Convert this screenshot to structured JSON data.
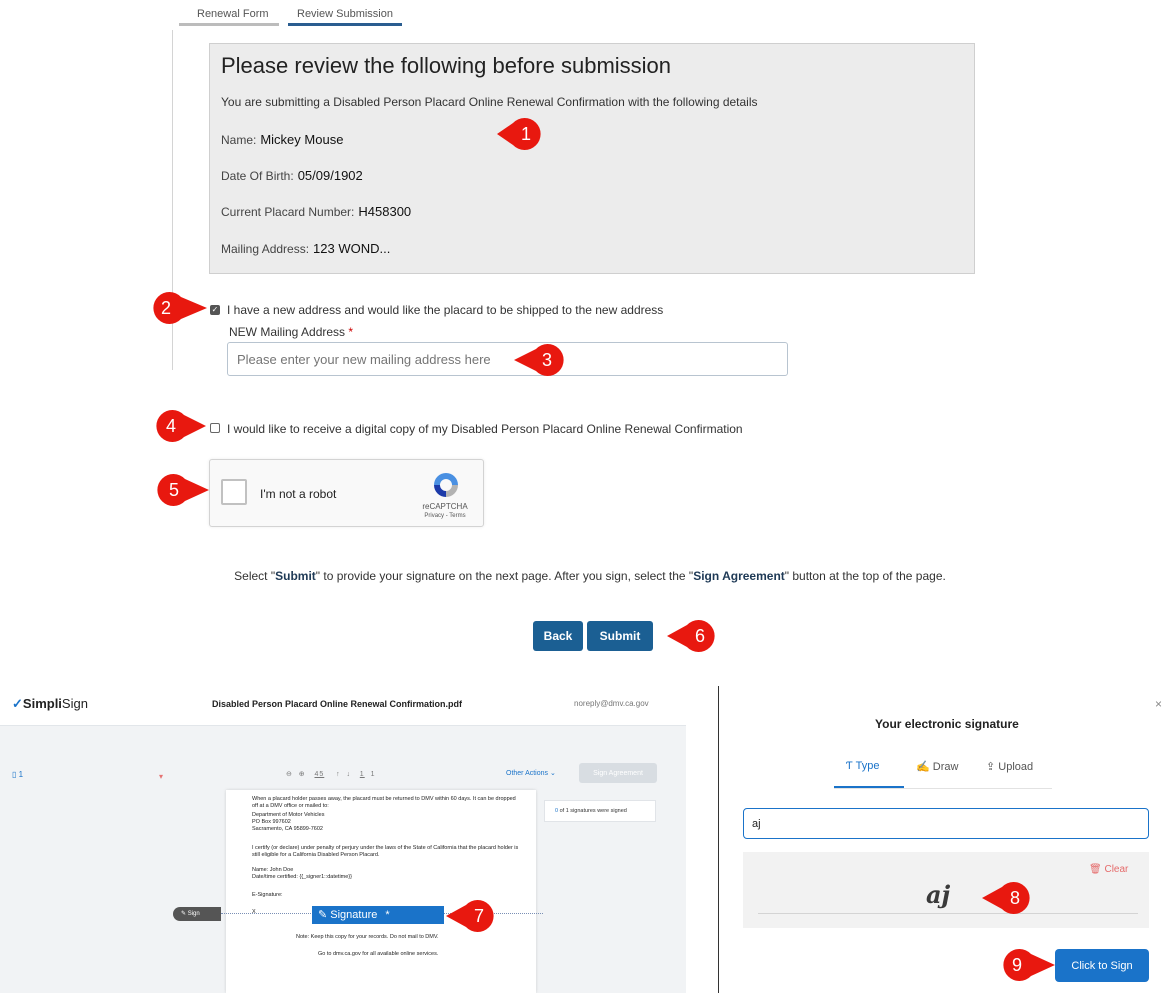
{
  "tabs": [
    "Renewal Form",
    "Review Submission"
  ],
  "review": {
    "title": "Please review the following before submission",
    "subtitle": "You are submitting a Disabled Person Placard Online Renewal Confirmation with the following details",
    "name_label": "Name:",
    "name_value": "Mickey Mouse",
    "dob_label": "Date Of Birth:",
    "dob_value": "05/09/1902",
    "placard_label": "Current Placard Number:",
    "placard_value": "H458300",
    "address_label": "Mailing Address:",
    "address_value": "123 WOND..."
  },
  "new_address": {
    "checkbox_label": "I have a new address and would like the placard to be shipped to the new address",
    "checked": true,
    "field_label": "NEW Mailing Address",
    "required_mark": "*",
    "placeholder": "Please enter your new mailing address here"
  },
  "digital_copy": {
    "checkbox_label": "I would like to receive a digital copy of my Disabled Person Placard Online Renewal Confirmation",
    "checked": false
  },
  "captcha": {
    "label": "I'm not a robot",
    "brand": "reCAPTCHA",
    "links": "Privacy - Terms"
  },
  "instructions": {
    "p1": "Select \"",
    "b1": "Submit",
    "p2": "\" to provide your signature on the next page. After you sign, select the \"",
    "b2": "Sign Agreement",
    "p3": "\" button at the top of the page."
  },
  "buttons": {
    "back": "Back",
    "submit": "Submit"
  },
  "callouts": [
    "1",
    "2",
    "3",
    "4",
    "5",
    "6",
    "7",
    "8",
    "9"
  ],
  "simplisign": {
    "logo_bold": "Simpli",
    "logo_rest": "Sign",
    "doc_title": "Disabled Person Placard Online Renewal Confirmation.pdf",
    "email": "noreply@dmv.ca.gov",
    "page_indicator": "1",
    "zoom": "45",
    "page_current": "1",
    "page_total": "1",
    "other_actions": "Other Actions",
    "sign_agreement": "Sign Agreement",
    "sig_count": "0",
    "sig_status_rest": "of 1 signatures were signed",
    "doc_lines": [
      "When a placard holder passes away, the placard must be returned to DMV within 60 days. It can be dropped off at a DMV office or mailed to:",
      "Department of Motor Vehicles",
      "PO Box 997602",
      "Sacramento, CA 95899-7602",
      "I certify (or declare) under penalty of perjury under the laws of the State of California that the placard holder is still eligible for a California Disabled Person Placard.",
      "Name: John Doe",
      "Date/time certified: {{_signer1::datetime}}",
      "E-Signature:",
      "X",
      "Note: Keep this copy for your records. Do not mail to DMV.",
      "Go to dmv.ca.gov for all available online services."
    ],
    "sign_tag": "Sign",
    "signature_field": "Signature",
    "signature_required": "*"
  },
  "signature_dialog": {
    "close": "×",
    "title": "Your electronic signature",
    "tabs": [
      "Type",
      "Draw",
      "Upload"
    ],
    "active_tab": "Type",
    "input_value": "aj",
    "clear": "Clear",
    "preview": "aj",
    "button": "Click to Sign"
  },
  "colors": {
    "primary_button": "#1b5f93",
    "callout": "#e8180f",
    "accent": "#1a73c9"
  }
}
